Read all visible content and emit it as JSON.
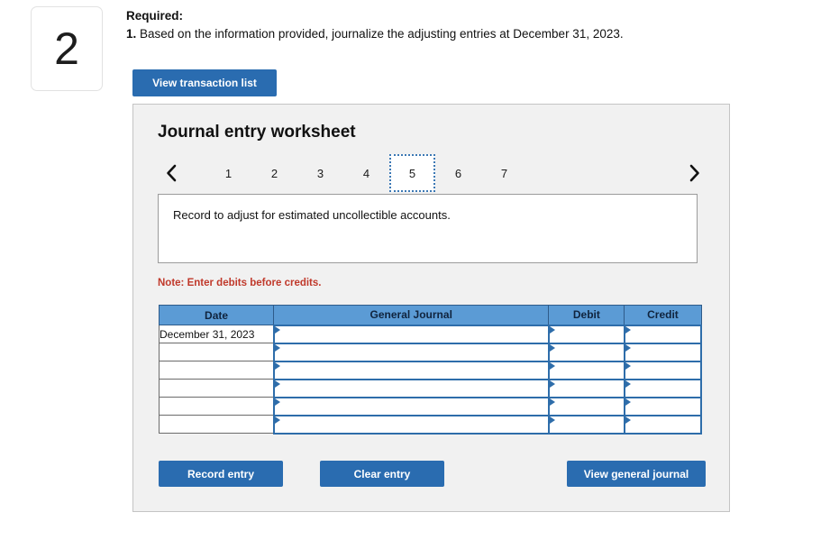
{
  "question_number": "2",
  "required": {
    "label": "Required:",
    "item_number": "1.",
    "item_text": "Based on the information provided, journalize the adjusting entries at December 31, 2023."
  },
  "view_transaction_button": "View transaction list",
  "worksheet": {
    "title": "Journal entry worksheet",
    "prev_icon": "chevron-left-icon",
    "next_icon": "chevron-right-icon",
    "tabs": [
      "1",
      "2",
      "3",
      "4",
      "5",
      "6",
      "7"
    ],
    "active_tab": "5",
    "description": "Record to adjust for estimated uncollectible accounts.",
    "note": "Note: Enter debits before credits.",
    "table": {
      "headers": [
        "Date",
        "General Journal",
        "Debit",
        "Credit"
      ],
      "rows": [
        {
          "date": "December 31, 2023",
          "general_journal": "",
          "debit": "",
          "credit": ""
        },
        {
          "date": "",
          "general_journal": "",
          "debit": "",
          "credit": ""
        },
        {
          "date": "",
          "general_journal": "",
          "debit": "",
          "credit": ""
        },
        {
          "date": "",
          "general_journal": "",
          "debit": "",
          "credit": ""
        },
        {
          "date": "",
          "general_journal": "",
          "debit": "",
          "credit": ""
        },
        {
          "date": "",
          "general_journal": "",
          "debit": "",
          "credit": ""
        }
      ]
    },
    "buttons": {
      "record_entry": "Record entry",
      "clear_entry": "Clear entry",
      "view_general_journal": "View general journal"
    }
  },
  "colors": {
    "button_blue": "#2a6cb0",
    "table_header_blue": "#5b9bd5",
    "cell_border_blue": "#2e6daa",
    "note_red": "#c0392b",
    "panel_gray": "#f1f1f1"
  }
}
